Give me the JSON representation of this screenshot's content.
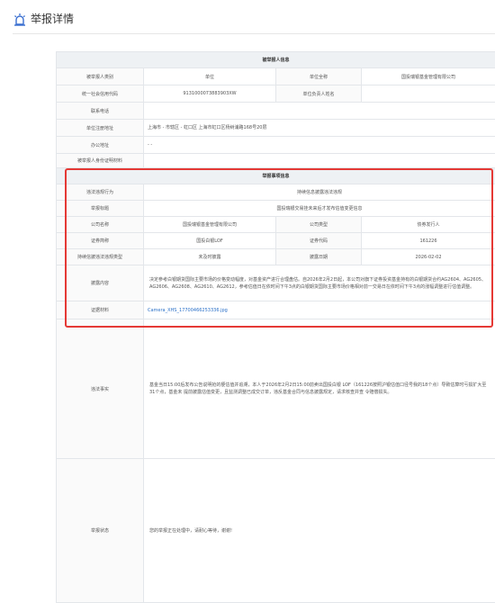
{
  "page": {
    "title": "举报详情",
    "icon": "alarm-siren-icon"
  },
  "reported": {
    "section_title": "被举报人信息",
    "type_label": "被举报人类别",
    "type_value": "单位",
    "name_label": "单位全称",
    "name_value": "国投瑞银基金管理有限公司",
    "credit_label": "统一社会信用代码",
    "credit_value": "9131000073883903XW",
    "head_label": "单位负责人姓名",
    "head_value": "",
    "phone_label": "联系电话",
    "phone_value": "",
    "reg_addr_label": "单位注册地址",
    "reg_addr_value": "上海市 - 市辖区 - 虹口区 上海市虹口区杨树浦路168号20层",
    "office_label": "办公地址",
    "office_value": "- -",
    "idmat_label": "被举报人身份证明材料",
    "idmat_value": ""
  },
  "matter": {
    "section_title": "举报事项信息",
    "behavior_label": "违法违规行为",
    "behavior_value": "持续信息披露违法违规",
    "subject_label": "举报标题",
    "subject_value": "国投瑞银交易挂未来后才发布估值变更信息",
    "company_label": "公司名称",
    "company_value": "国投瑞银基金管理有限公司",
    "ctype_label": "公司类型",
    "ctype_value": "债券发行人",
    "sec_name_label": "证券简称",
    "sec_name_value": "国投白银LOF",
    "sec_code_label": "证券代码",
    "sec_code_value": "161226",
    "viol_type_label": "持续信披违法违规类型",
    "viol_type_value": "未及时披露",
    "date_label": "披露日期",
    "date_value": "2026-02-02",
    "content_label": "披露内容",
    "content_value": "决定参考白银期货国际主要市场的价格变动幅度，对基金资产进行合理盘估。自2026年2月2日起，本公司对旗下证券投资基金持有的白银期货合约AG2604、AG2605、AG2606、AG2608、AG2610、AG2612，参考估值日在依时间下午3点的白银期货国际主要市场价格相对前一交易日在依时间下午3点的涨幅调整进行估值调整。",
    "evidence_label": "证据材料",
    "evidence_value": "Camera_XHS_17700466253336.jpg"
  },
  "facts": {
    "label": "违法事实",
    "value": "基金当日15:00后发布公告说明抢的梗估值并追溯，本人于2026年2月2日15:00前卖出国投白银 LOF（161226按照沪银估值口径号我的18个点）导致估算时亏损扩大至31个点，基金未 提前披露估值变更，且监测调整已成交订单，违反基金合同与信息披露规定，请求核查并查 令赔偿损失。"
  },
  "status": {
    "label": "举报状态",
    "value": "您的举报正在处理中，请耐心等待，谢谢!"
  }
}
